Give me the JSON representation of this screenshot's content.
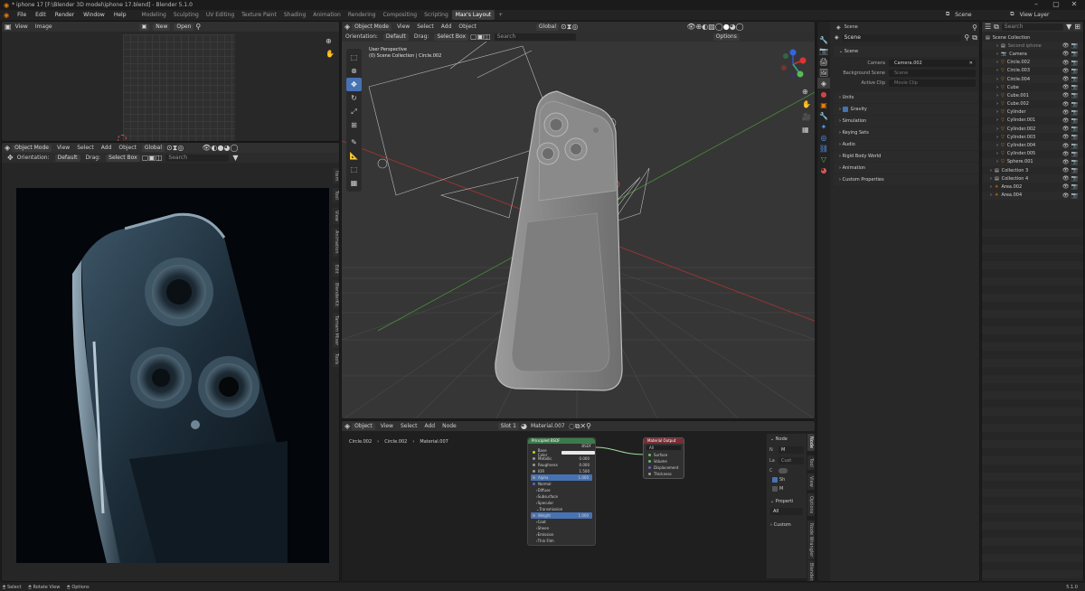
{
  "window": {
    "title": "* iphone 17 [F:\\Blender 3D model\\iphone 17.blend] - Blender 5.1.0"
  },
  "menus": [
    "File",
    "Edit",
    "Render",
    "Window",
    "Help"
  ],
  "workspaces": [
    "Modeling",
    "Sculpting",
    "UV Editing",
    "Texture Paint",
    "Shading",
    "Animation",
    "Rendering",
    "Compositing",
    "Scripting",
    "Max's Layout"
  ],
  "scene": {
    "label": "Scene",
    "view_layer": "View Layer"
  },
  "image_editor": {
    "view": "View",
    "image": "Image",
    "new": "New",
    "open": "Open"
  },
  "viewport_small": {
    "mode": "Object Mode",
    "view": "View",
    "select": "Select",
    "add": "Add",
    "object": "Object",
    "transform": "Global",
    "orientation_label": "Orientation:",
    "orientation": "Default",
    "drag_label": "Drag:",
    "drag": "Select Box",
    "search": "Search"
  },
  "render_tabs": [
    "Item",
    "Tool",
    "View",
    "Animation",
    "Edit",
    "BlenderKit",
    "Tamam Mixer",
    "A - Tools"
  ],
  "viewport_main": {
    "mode": "Object Mode",
    "view": "View",
    "select": "Select",
    "add": "Add",
    "object": "Object",
    "transform": "Global",
    "orientation_label": "Orientation:",
    "orientation": "Default",
    "drag_label": "Drag:",
    "drag": "Select Box",
    "search": "Search",
    "options": "Options",
    "info_line1": "User Perspective",
    "info_line2": "(0) Scene Collection | Circle.002"
  },
  "node_editor": {
    "mode": "Object",
    "view": "View",
    "select": "Select",
    "add": "Add",
    "node": "Node",
    "slot": "Slot 1",
    "material": "Material.007",
    "breadcrumb": [
      "Circle.002",
      "Circle.002",
      "Material.007"
    ]
  },
  "principled": {
    "title": "Principled BSDF",
    "out": "BSDF",
    "fields": [
      {
        "label": "Base Color",
        "value": ""
      },
      {
        "label": "Metallic",
        "value": "0.000"
      },
      {
        "label": "Roughness",
        "value": "0.000"
      },
      {
        "label": "IOR",
        "value": "1.500"
      },
      {
        "label": "Alpha",
        "value": "1.000"
      }
    ],
    "normal": "Normal",
    "subs": [
      "Diffuse",
      "Subsurface",
      "Specular",
      "Transmission"
    ],
    "weight": {
      "label": "Weight",
      "value": "1.000"
    },
    "more": [
      "Coat",
      "Sheen",
      "Emission",
      "Thin Film"
    ]
  },
  "matout": {
    "title": "Material Output",
    "target": "All",
    "sockets": [
      "Surface",
      "Volume",
      "Displacement",
      "Thickness"
    ]
  },
  "node_side": {
    "node": "Node",
    "name_short": "N",
    "name_val": "M",
    "label_short": "La",
    "label_val": "Cust",
    "color_short": "C",
    "properties": "Properti",
    "all": "All",
    "custom": "Custom",
    "check1": "Sh",
    "check2": "M",
    "tabs": [
      "Node",
      "Tool",
      "View",
      "Options",
      "Node Wrangler",
      "Blender..."
    ]
  },
  "properties": {
    "header": "Scene",
    "scene_name": "Scene",
    "section": "Scene",
    "rows": [
      {
        "label": "Camera",
        "value": "Camera.002"
      },
      {
        "label": "Background Scene",
        "value": "Scene"
      },
      {
        "label": "Active Clip",
        "value": "Movie Clip"
      }
    ],
    "sections": [
      "Units",
      "Gravity",
      "Simulation",
      "Keying Sets",
      "Audio",
      "Rigid Body World",
      "Animation",
      "Custom Properties"
    ]
  },
  "outliner": {
    "search": "Search",
    "root": "Scene Collection",
    "items": [
      {
        "name": "Second iphone",
        "indent": 1,
        "icon": "collection",
        "dim": true
      },
      {
        "name": "Camera",
        "indent": 1,
        "icon": "camera"
      },
      {
        "name": "Circle.002",
        "indent": 1,
        "icon": "mesh"
      },
      {
        "name": "Circle.003",
        "indent": 1,
        "icon": "mesh"
      },
      {
        "name": "Circle.004",
        "indent": 1,
        "icon": "mesh"
      },
      {
        "name": "Cube",
        "indent": 1,
        "icon": "mesh"
      },
      {
        "name": "Cube.001",
        "indent": 1,
        "icon": "mesh"
      },
      {
        "name": "Cube.002",
        "indent": 1,
        "icon": "mesh"
      },
      {
        "name": "Cylinder",
        "indent": 1,
        "icon": "mesh"
      },
      {
        "name": "Cylinder.001",
        "indent": 1,
        "icon": "mesh"
      },
      {
        "name": "Cylinder.002",
        "indent": 1,
        "icon": "mesh"
      },
      {
        "name": "Cylinder.003",
        "indent": 1,
        "icon": "mesh"
      },
      {
        "name": "Cylinder.004",
        "indent": 1,
        "icon": "mesh"
      },
      {
        "name": "Cylinder.005",
        "indent": 1,
        "icon": "mesh"
      },
      {
        "name": "Sphere.001",
        "indent": 1,
        "icon": "mesh"
      },
      {
        "name": "Collection 3",
        "indent": 0,
        "icon": "collection"
      },
      {
        "name": "Collection 4",
        "indent": 0,
        "icon": "collection"
      },
      {
        "name": "Area.002",
        "indent": 0,
        "icon": "light"
      },
      {
        "name": "Area.004",
        "indent": 0,
        "icon": "light"
      }
    ]
  },
  "statusbar": {
    "select": "Select",
    "rotate": "Rotate View",
    "options": "Options",
    "version": "5.1.0"
  },
  "colors": {
    "accent": "#4772b3",
    "bg": "#282828",
    "header": "#303030"
  }
}
